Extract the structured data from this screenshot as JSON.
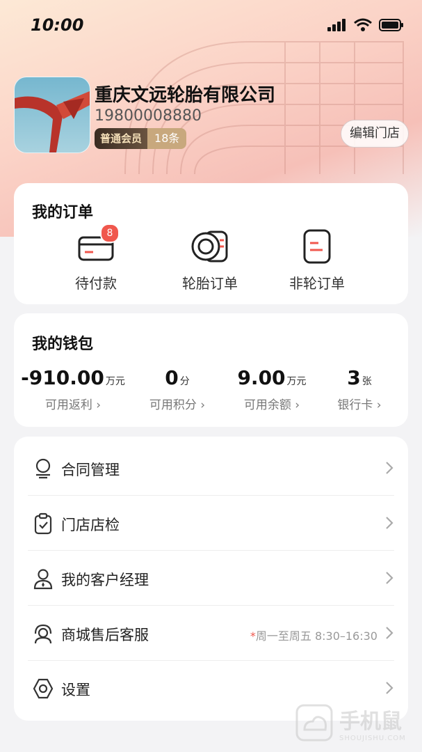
{
  "status_bar": {
    "time": "10:00"
  },
  "profile": {
    "company": "重庆文远轮胎有限公司",
    "phone": "19800008880",
    "member_level": "普通会员",
    "member_count": "18条",
    "edit_store": "编辑门店"
  },
  "orders": {
    "title": "我的订单",
    "items": [
      {
        "label": "待付款",
        "badge": "8",
        "icon": "card-icon"
      },
      {
        "label": "轮胎订单",
        "icon": "tire-icon"
      },
      {
        "label": "非轮订单",
        "icon": "document-icon"
      }
    ]
  },
  "wallet": {
    "title": "我的钱包",
    "items": [
      {
        "value": "-910.00",
        "unit": "万元",
        "label": "可用返利 ›"
      },
      {
        "value": "0",
        "unit": "分",
        "label": "可用积分 ›"
      },
      {
        "value": "9.00",
        "unit": "万元",
        "label": "可用余额 ›"
      },
      {
        "value": "3",
        "unit": "张",
        "label": "银行卡 ›"
      }
    ]
  },
  "menu": {
    "items": [
      {
        "label": "合同管理",
        "icon": "contract-icon"
      },
      {
        "label": "门店店检",
        "icon": "checklist-icon"
      },
      {
        "label": "我的客户经理",
        "icon": "manager-icon"
      },
      {
        "label": "商城售后客服",
        "icon": "service-icon",
        "hint_star": "*",
        "hint": "周一至周五 8:30–16:30"
      },
      {
        "label": "设置",
        "icon": "settings-icon"
      }
    ]
  },
  "watermark": {
    "text": "手机鼠",
    "sub": "SHOUJISHU.COM"
  },
  "colors": {
    "accent": "#f0574d",
    "background": "#f3f3f5"
  }
}
